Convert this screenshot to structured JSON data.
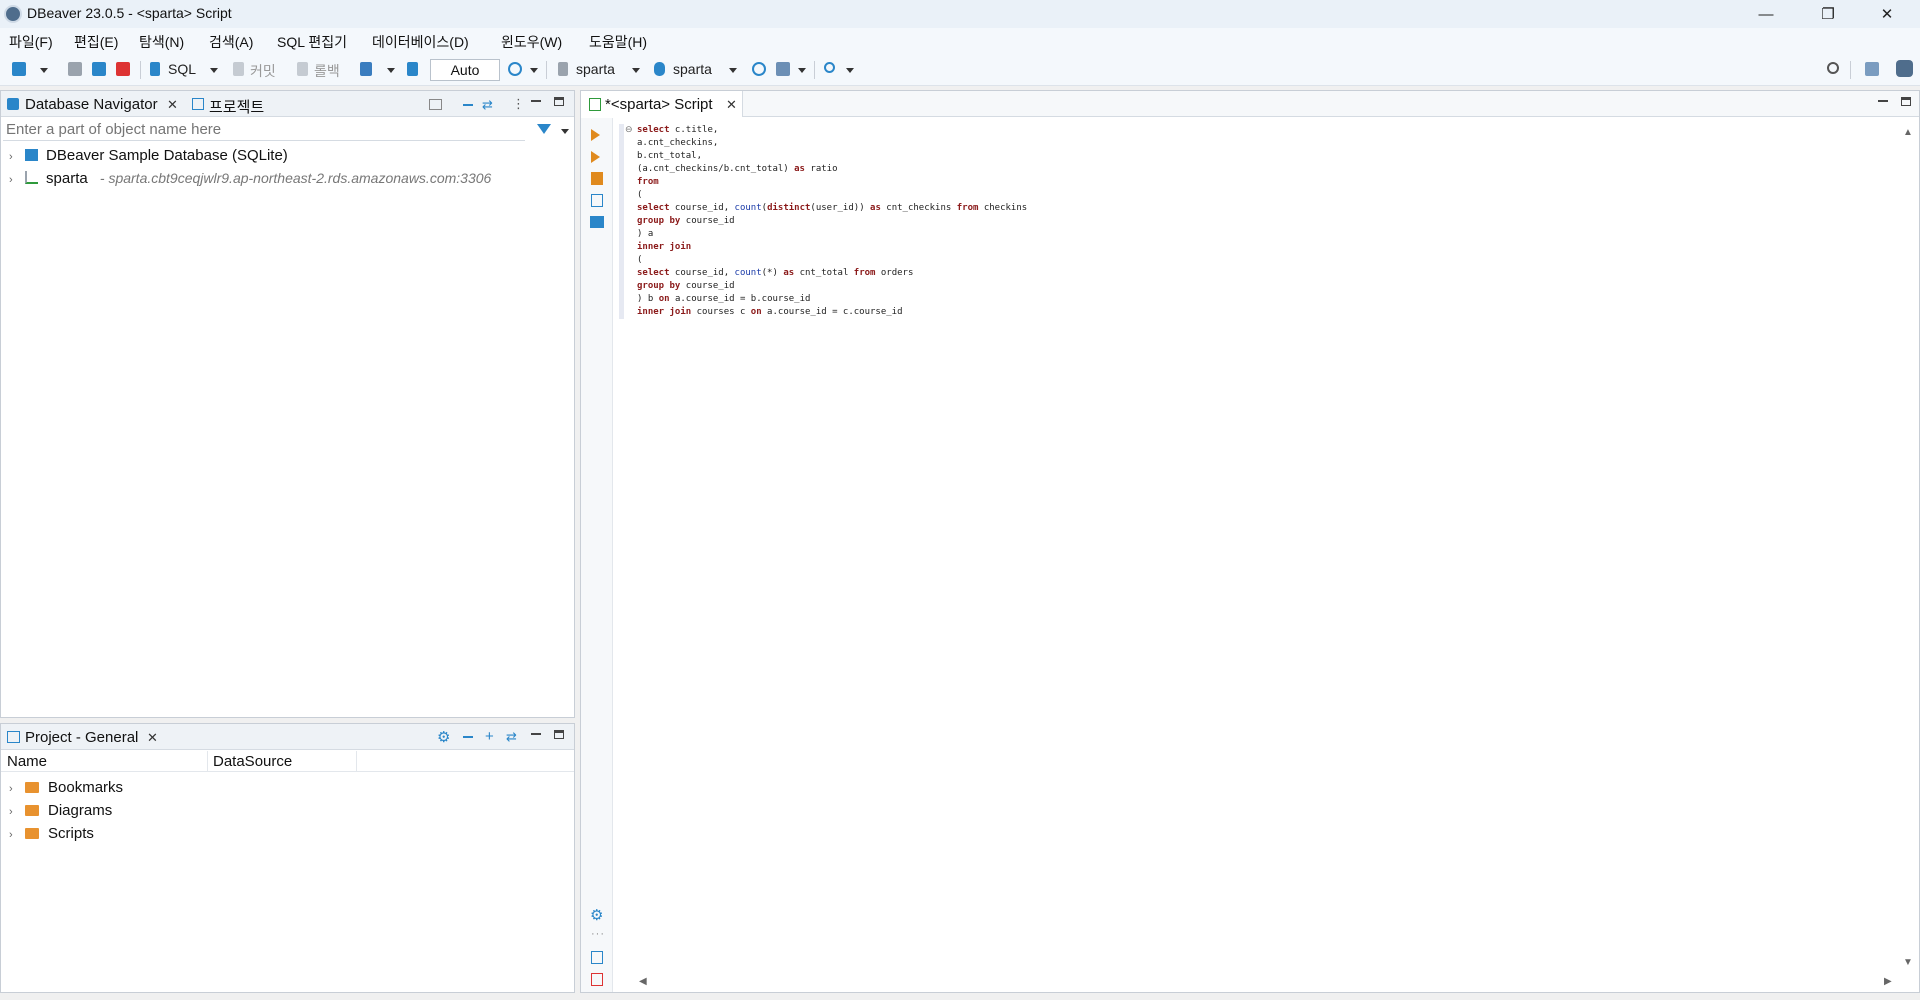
{
  "window": {
    "title": "DBeaver 23.0.5 - <sparta> Script",
    "minimize": "—",
    "restore": "❐",
    "close": "✕"
  },
  "menu": [
    "파일(F)",
    "편집(E)",
    "탐색(N)",
    "검색(A)",
    "SQL 편집기",
    "데이터베이스(D)",
    "윈도우(W)",
    "도움말(H)"
  ],
  "toolbar": {
    "sql_label": "SQL",
    "commit_label": "커밋",
    "rollback_label": "롤백",
    "transaction_mode": "Auto",
    "datasource": "sparta",
    "schema": "sparta"
  },
  "navigator": {
    "tab_label": "Database Navigator",
    "tab2_label": "프로젝트",
    "filter_placeholder": "Enter a part of object name here",
    "items": [
      {
        "label": "DBeaver Sample Database (SQLite)",
        "detail": ""
      },
      {
        "label": "sparta",
        "detail": "- sparta.cbt9ceqjwlr9.ap-northeast-2.rds.amazonaws.com:3306"
      }
    ]
  },
  "project": {
    "tab_label": "Project - General",
    "columns": [
      "Name",
      "DataSource"
    ],
    "items": [
      "Bookmarks",
      "Diagrams",
      "Scripts"
    ]
  },
  "editor": {
    "tab_label": "*<sparta> Script",
    "lines": [
      [
        {
          "t": "select",
          "c": "kw"
        },
        {
          "t": " c.title,"
        }
      ],
      [
        {
          "t": "a.cnt_checkins,"
        }
      ],
      [
        {
          "t": "b.cnt_total,"
        }
      ],
      [
        {
          "t": "(a.cnt_checkins/b.cnt_total) "
        },
        {
          "t": "as",
          "c": "kw"
        },
        {
          "t": " ratio"
        }
      ],
      [
        {
          "t": "from",
          "c": "kw"
        }
      ],
      [
        {
          "t": "("
        }
      ],
      [
        {
          "t": "select",
          "c": "kw"
        },
        {
          "t": " course_id, "
        },
        {
          "t": "count",
          "c": "fn"
        },
        {
          "t": "("
        },
        {
          "t": "distinct",
          "c": "kw"
        },
        {
          "t": "(user_id)) "
        },
        {
          "t": "as",
          "c": "kw"
        },
        {
          "t": " cnt_checkins "
        },
        {
          "t": "from",
          "c": "kw"
        },
        {
          "t": " checkins"
        }
      ],
      [
        {
          "t": "group by",
          "c": "kw"
        },
        {
          "t": " course_id"
        }
      ],
      [
        {
          "t": ") a"
        }
      ],
      [
        {
          "t": "inner join",
          "c": "kw"
        }
      ],
      [
        {
          "t": "("
        }
      ],
      [
        {
          "t": "select",
          "c": "kw"
        },
        {
          "t": " course_id, "
        },
        {
          "t": "count",
          "c": "fn"
        },
        {
          "t": "(*) "
        },
        {
          "t": "as",
          "c": "kw"
        },
        {
          "t": " cnt_total "
        },
        {
          "t": "from",
          "c": "kw"
        },
        {
          "t": " orders"
        }
      ],
      [
        {
          "t": "group by",
          "c": "kw"
        },
        {
          "t": " course_id"
        }
      ],
      [
        {
          "t": ") b "
        },
        {
          "t": "on",
          "c": "kw"
        },
        {
          "t": " a.course_id = b.course_id"
        }
      ],
      [
        {
          "t": "inner join",
          "c": "kw"
        },
        {
          "t": " courses c "
        },
        {
          "t": "on",
          "c": "kw"
        },
        {
          "t": " a.course_id = c.course_id"
        }
      ]
    ]
  }
}
